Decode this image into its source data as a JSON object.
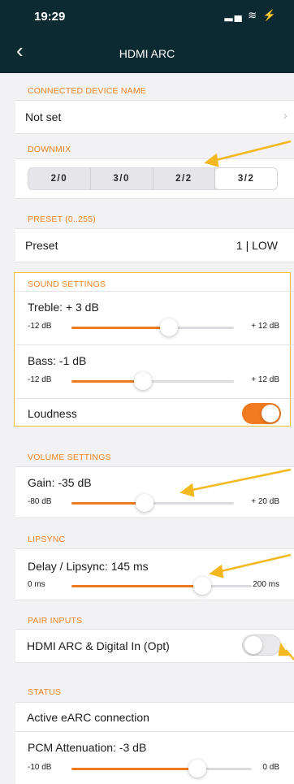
{
  "status": {
    "time": "19:29",
    "indicators": "▂▄ ≋ ⚡"
  },
  "nav": {
    "back_icon": "‹",
    "title": "HDMI ARC"
  },
  "connected_device": {
    "header": "CONNECTED DEVICE NAME",
    "value": "Not set",
    "chevron": "›"
  },
  "downmix": {
    "header": "DOWNMIX",
    "options": [
      "2/0",
      "3/0",
      "2/2",
      "3/2"
    ],
    "selected": "3/2"
  },
  "preset": {
    "header": "PRESET (0..255)",
    "label": "Preset",
    "value": "1 | LOW"
  },
  "sound": {
    "header": "SOUND SETTINGS",
    "treble": {
      "label": "Treble:  + 3 dB",
      "min": "-12 dB",
      "max": "+ 12 dB",
      "fraction": 0.6
    },
    "bass": {
      "label": "Bass:   -1 dB",
      "min": "-12 dB",
      "max": "+ 12 dB",
      "fraction": 0.44
    },
    "loudness": {
      "label": "Loudness",
      "on": true
    }
  },
  "volume": {
    "header": "VOLUME SETTINGS",
    "gain": {
      "label": "Gain:   -35 dB",
      "min": "-80 dB",
      "max": "+ 20 dB",
      "fraction": 0.45
    }
  },
  "lipsync": {
    "header": "LIPSYNC",
    "delay": {
      "label": "Delay / Lipsync:  145 ms",
      "min": "0 ms",
      "max": "200 ms",
      "fraction": 0.725
    }
  },
  "pair_inputs": {
    "header": "PAIR INPUTS",
    "label": "HDMI ARC & Digital In (Opt)",
    "on": false
  },
  "status_section": {
    "header": "STATUS",
    "connection": "Active eARC connection",
    "pcm": {
      "label": "PCM Attenuation:   -3 dB",
      "min": "-10 dB",
      "max": "0 dB",
      "fraction": 0.7
    }
  },
  "colors": {
    "accent": "#ef7a1f",
    "highlight_box": "#f3c135",
    "annotation_arrow": "#f3b81f",
    "navbar": "#0d2a33"
  }
}
